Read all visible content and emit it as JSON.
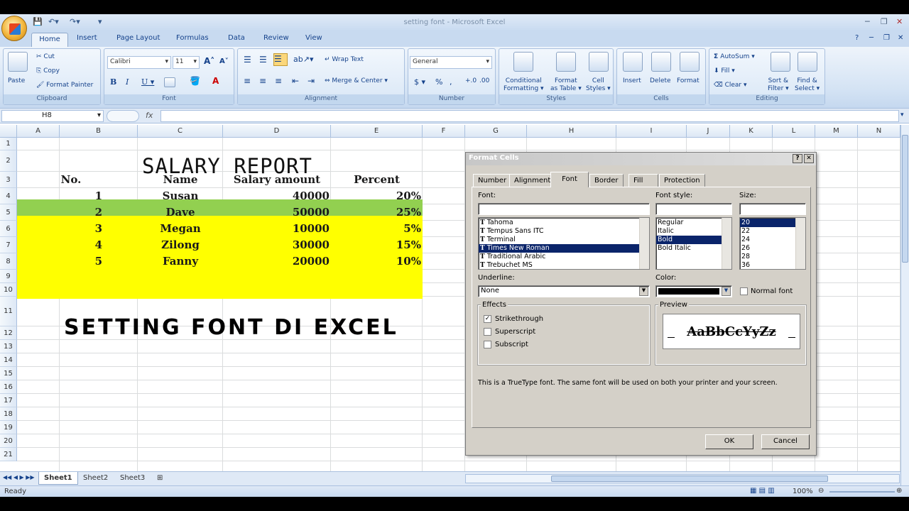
{
  "window": {
    "title": "setting font - Microsoft Excel"
  },
  "ribbon_tabs": [
    "Home",
    "Insert",
    "Page Layout",
    "Formulas",
    "Data",
    "Review",
    "View"
  ],
  "clipboard": {
    "paste": "Paste",
    "cut": "Cut",
    "copy": "Copy",
    "format_painter": "Format Painter",
    "label": "Clipboard"
  },
  "font_group": {
    "font_name": "Calibri",
    "font_size": "11",
    "label": "Font"
  },
  "alignment": {
    "wrap_text": "Wrap Text",
    "merge_center": "Merge & Center",
    "label": "Alignment"
  },
  "number": {
    "format": "General",
    "label": "Number"
  },
  "styles": {
    "conditional": "Conditional",
    "conditional2": "Formatting",
    "format_table": "Format",
    "format_table2": "as Table",
    "cell_styles": "Cell",
    "cell_styles2": "Styles",
    "label": "Styles"
  },
  "cells": {
    "insert": "Insert",
    "delete": "Delete",
    "format": "Format",
    "label": "Cells"
  },
  "editing": {
    "autosum": "AutoSum",
    "fill": "Fill",
    "clear": "Clear",
    "sort": "Sort &",
    "sort2": "Filter",
    "find": "Find &",
    "find2": "Select",
    "label": "Editing"
  },
  "formula_bar": {
    "name_box": "H8",
    "fx": "fx",
    "value": ""
  },
  "columns": [
    "A",
    "B",
    "C",
    "D",
    "E",
    "F",
    "G",
    "H",
    "I",
    "J",
    "K",
    "L",
    "M",
    "N"
  ],
  "rows": [
    "1",
    "2",
    "3",
    "4",
    "5",
    "6",
    "7",
    "8",
    "9",
    "10",
    "11",
    "12",
    "13",
    "14",
    "15",
    "16",
    "17",
    "18",
    "19",
    "20",
    "21"
  ],
  "sheet": {
    "title": "SALARY REPORT",
    "headers": [
      "No.",
      "Name",
      "Salary amount",
      "Percent"
    ],
    "data": [
      [
        "1",
        "Susan",
        "40000",
        "20%"
      ],
      [
        "2",
        "Dave",
        "50000",
        "25%"
      ],
      [
        "3",
        "Megan",
        "10000",
        "5%"
      ],
      [
        "4",
        "Zilong",
        "30000",
        "15%"
      ],
      [
        "5",
        "Fanny",
        "20000",
        "10%"
      ]
    ],
    "banner": "SETTING FONT DI EXCEL",
    "header_color": "#92d050",
    "data_color": "#ffff00"
  },
  "sheet_tabs": [
    "Sheet1",
    "Sheet2",
    "Sheet3"
  ],
  "status": {
    "ready": "Ready",
    "zoom": "100%"
  },
  "dialog": {
    "title": "Format Cells",
    "tabs": [
      "Number",
      "Alignment",
      "Font",
      "Border",
      "Fill",
      "Protection"
    ],
    "font_label": "Font:",
    "style_label": "Font style:",
    "size_label": "Size:",
    "fonts": [
      "Tahoma",
      "Tempus Sans ITC",
      "Terminal",
      "Times New Roman",
      "Traditional Arabic",
      "Trebuchet MS"
    ],
    "styles": [
      "Regular",
      "Italic",
      "Bold",
      "Bold Italic"
    ],
    "sizes": [
      "20",
      "22",
      "24",
      "26",
      "28",
      "36"
    ],
    "underline_label": "Underline:",
    "underline_value": "None",
    "color_label": "Color:",
    "normal_font": "Normal font",
    "effects_label": "Effects",
    "strikethrough": "Strikethrough",
    "superscript": "Superscript",
    "subscript": "Subscript",
    "preview_label": "Preview",
    "preview_text": "AaBbCcYyZz",
    "info": "This is a TrueType font.  The same font will be used on both your printer and your screen.",
    "ok": "OK",
    "cancel": "Cancel"
  }
}
